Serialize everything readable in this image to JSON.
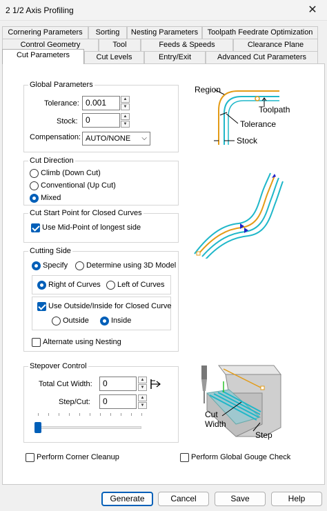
{
  "window": {
    "title": "2 1/2 Axis Profiling",
    "close_glyph": "✕"
  },
  "tabs": {
    "row1": [
      "Cornering Parameters",
      "Sorting",
      "Nesting Parameters",
      "Toolpath Feedrate Optimization"
    ],
    "row2": [
      "Control Geometry",
      "Tool",
      "Feeds & Speeds",
      "Clearance Plane"
    ],
    "row3": [
      "Cut Parameters",
      "Cut Levels",
      "Entry/Exit",
      "Advanced Cut Parameters"
    ],
    "active": "Cut Parameters"
  },
  "global_parameters": {
    "legend": "Global Parameters",
    "tolerance_label": "Tolerance:",
    "tolerance_value": "0.001",
    "stock_label": "Stock:",
    "stock_value": "0",
    "compensation_label": "Compensation:",
    "compensation_value": "AUTO/NONE"
  },
  "cut_direction": {
    "legend": "Cut Direction",
    "options": [
      "Climb (Down Cut)",
      "Conventional (Up Cut)",
      "Mixed"
    ],
    "selected": "Mixed"
  },
  "cut_start": {
    "legend": "Cut Start Point for Closed Curves",
    "midpoint_label": "Use Mid-Point of longest side",
    "midpoint_checked": true
  },
  "cutting_side": {
    "legend": "Cutting Side",
    "specify_label": "Specify",
    "determine_label": "Determine using 3D Model",
    "mode": "Specify",
    "right_label": "Right of Curves",
    "left_label": "Left of Curves",
    "side": "Right of Curves",
    "use_outside_inside_label": "Use Outside/Inside for Closed Curve",
    "use_outside_inside_checked": true,
    "outside_label": "Outside",
    "inside_label": "Inside",
    "closed_side": "Inside",
    "alternate_label": "Alternate using Nesting",
    "alternate_checked": false
  },
  "stepover": {
    "legend": "Stepover Control",
    "total_width_label": "Total Cut Width:",
    "total_width_value": "0",
    "step_cut_label": "Step/Cut:",
    "step_cut_value": "0",
    "slider_level": 0
  },
  "diagram_labels": {
    "region": "Region",
    "toolpath": "Toolpath",
    "tolerance": "Tolerance",
    "stock": "Stock",
    "cut_width": "Cut\nWidth",
    "step": "Step"
  },
  "bottom_checks": {
    "corner_cleanup_label": "Perform Corner Cleanup",
    "corner_cleanup_checked": false,
    "gouge_check_label": "Perform Global Gouge Check",
    "gouge_check_checked": false
  },
  "buttons": {
    "generate": "Generate",
    "cancel": "Cancel",
    "save": "Save",
    "help": "Help"
  },
  "colors": {
    "accent": "#005fb8",
    "region_curve": "#e39b16",
    "toolpath_curve": "#1fb7c9",
    "arrow_blue": "#2323c9"
  }
}
